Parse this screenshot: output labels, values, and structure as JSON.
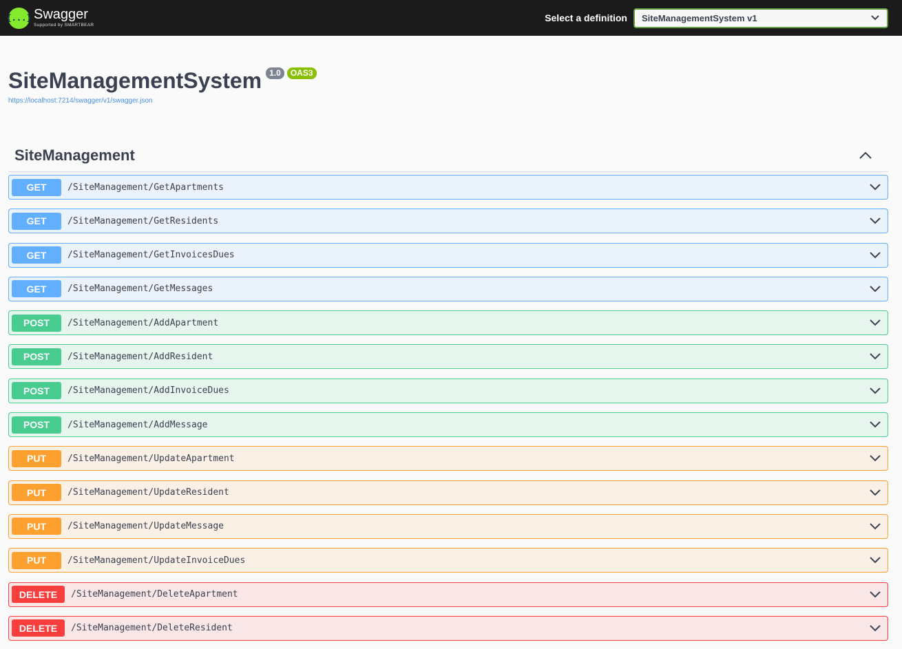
{
  "topbar": {
    "brand_name": "Swagger",
    "brand_sub": "Supported by SMARTBEAR",
    "logo_glyph": "{...}",
    "definition_label": "Select a definition",
    "definition_selected": "SiteManagementSystem v1"
  },
  "info": {
    "title": "SiteManagementSystem",
    "version": "1.0",
    "oas": "OAS3",
    "url": "https://localhost:7214/swagger/v1/swagger.json"
  },
  "tag": {
    "name": "SiteManagement",
    "operations": [
      {
        "method": "GET",
        "path": "/SiteManagement/GetApartments"
      },
      {
        "method": "GET",
        "path": "/SiteManagement/GetResidents"
      },
      {
        "method": "GET",
        "path": "/SiteManagement/GetInvoicesDues"
      },
      {
        "method": "GET",
        "path": "/SiteManagement/GetMessages"
      },
      {
        "method": "POST",
        "path": "/SiteManagement/AddApartment"
      },
      {
        "method": "POST",
        "path": "/SiteManagement/AddResident"
      },
      {
        "method": "POST",
        "path": "/SiteManagement/AddInvoiceDues"
      },
      {
        "method": "POST",
        "path": "/SiteManagement/AddMessage"
      },
      {
        "method": "PUT",
        "path": "/SiteManagement/UpdateApartment"
      },
      {
        "method": "PUT",
        "path": "/SiteManagement/UpdateResident"
      },
      {
        "method": "PUT",
        "path": "/SiteManagement/UpdateMessage"
      },
      {
        "method": "PUT",
        "path": "/SiteManagement/UpdateInvoiceDues"
      },
      {
        "method": "DELETE",
        "path": "/SiteManagement/DeleteApartment"
      },
      {
        "method": "DELETE",
        "path": "/SiteManagement/DeleteResident"
      }
    ]
  },
  "colors": {
    "get": "#61affe",
    "post": "#49cc90",
    "put": "#fca130",
    "delete": "#f93e3e"
  }
}
